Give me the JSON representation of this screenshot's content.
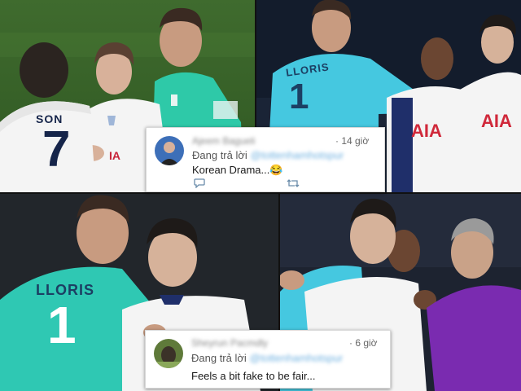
{
  "panels": [
    {
      "id": "top-left",
      "jerseys": [
        {
          "name_text": "SON",
          "number_text": "7",
          "color": "#f4f4f4"
        },
        {
          "name_text": "",
          "number_text": "",
          "color": "#2ec9a8"
        }
      ],
      "sponsor_text": "",
      "badge_text": "",
      "colors": {
        "pitch": "#3f6b2e",
        "home_kit": "#f4f4f4",
        "keeper_kit": "#2ec9a8",
        "kit_text": "#16254a"
      }
    },
    {
      "id": "top-right",
      "jerseys": [
        {
          "name_text": "LLORIS",
          "number_text": "1",
          "color": "#45c8e0"
        },
        {
          "name_text": "",
          "number_text": "",
          "color": "#f4f4f4"
        }
      ],
      "sponsor_text": "AIA",
      "badge_text": "",
      "colors": {
        "background": "#1a2436",
        "keeper_kit": "#45c8e0",
        "home_kit": "#f4f4f4",
        "sponsor": "#d0283a"
      }
    },
    {
      "id": "bottom-left",
      "jerseys": [
        {
          "name_text": "LLORIS",
          "number_text": "1",
          "color": "#2fc8b3"
        },
        {
          "name_text": "",
          "number_text": "",
          "color": "#f4f4f4"
        }
      ],
      "sponsor_text": "",
      "badge_text": "",
      "colors": {
        "background": "#22262b",
        "keeper_kit": "#2fc8b3",
        "home_kit": "#f4f4f4"
      }
    },
    {
      "id": "bottom-right",
      "jerseys": [
        {
          "name_text": "",
          "number_text": "",
          "color": "#f4f4f4"
        },
        {
          "name_text": "",
          "number_text": "",
          "color": "#7a2bb0"
        }
      ],
      "sponsor_text": "",
      "badge_text": "",
      "colors": {
        "background": "#1d2330",
        "home_kit": "#f4f4f4",
        "keeper_kit": "#45c8e0",
        "coach_jacket": "#7a2bb0"
      }
    }
  ],
  "comments": [
    {
      "author": "Ajeem Bagueli",
      "time": "· 14 giờ",
      "reply_label": "Đang trả lời",
      "reply_to": "@tottenhamhotspur",
      "text": "Korean Drama...😂",
      "actions": [
        "reply-icon",
        "retweet-icon"
      ]
    },
    {
      "author": "Sheyrun Pacmdly",
      "time": "· 6 giờ",
      "reply_label": "Đang trả lời",
      "reply_to": "@tottenhamhotspur",
      "text": "Feels a bit fake to be fair...",
      "actions": []
    }
  ],
  "colors": {
    "card_bg": "#ffffff",
    "muted_text": "#666666",
    "link_blue": "#6fb1e0",
    "icon_blue": "#6a8caa"
  }
}
